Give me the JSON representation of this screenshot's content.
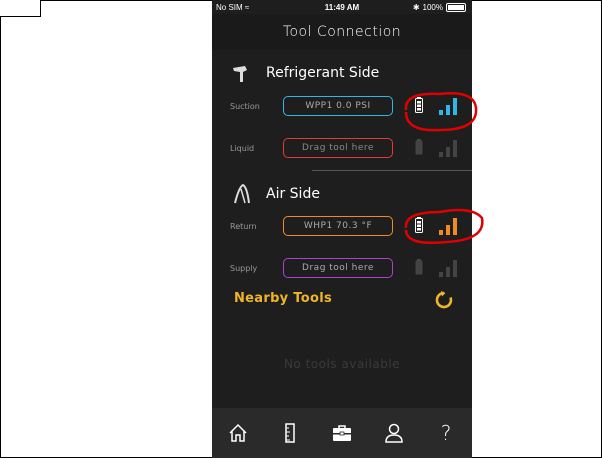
{
  "status_bar": {
    "carrier": "No SIM",
    "time": "11:49 AM",
    "battery": "100%"
  },
  "header": {
    "title": "Tool Connection"
  },
  "refrigerant": {
    "title": "Refrigerant Side",
    "suction": {
      "label": "Suction",
      "value": "WPP1   0.0 PSI",
      "signal_color": "#33b5e5"
    },
    "liquid": {
      "label": "Liquid",
      "value": "Drag tool here"
    }
  },
  "air": {
    "title": "Air Side",
    "return": {
      "label": "Return",
      "value": "WHP1   70.3 °F",
      "signal_color": "#f08a24"
    },
    "supply": {
      "label": "Supply",
      "value": "Drag tool here"
    }
  },
  "nearby": {
    "title": "Nearby Tools",
    "empty_text": "No tools available"
  },
  "tabbar": {
    "items": [
      "home-icon",
      "ruler-icon",
      "toolbox-icon",
      "user-icon",
      "help-icon"
    ],
    "help_glyph": "?"
  },
  "colors": {
    "accent": "#f0b429",
    "blue": "#33b5e5",
    "orange": "#f08a24",
    "annotation": "#e00000"
  }
}
